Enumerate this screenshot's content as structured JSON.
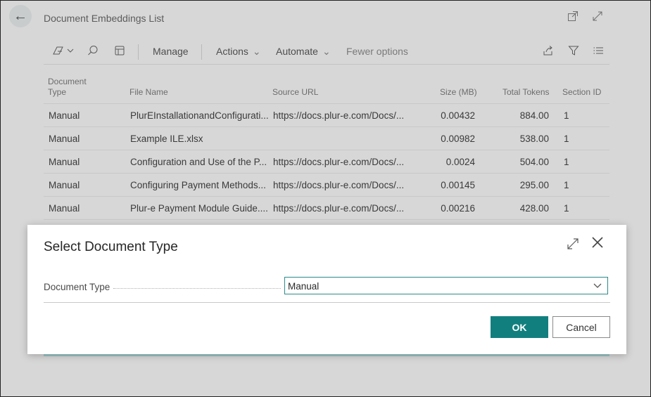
{
  "header": {
    "title": "Document Embeddings List",
    "icons": [
      "back-arrow-icon",
      "open-in-new-window-icon",
      "expand-icon"
    ]
  },
  "actionbar": {
    "manage": "Manage",
    "actions": "Actions",
    "automate": "Automate",
    "fewer_options": "Fewer options",
    "icons": [
      "view-switch-icon",
      "search-icon",
      "tile-view-icon",
      "share-icon",
      "filter-icon",
      "list-view-icon"
    ]
  },
  "table": {
    "columns": [
      "Document Type",
      "File Name",
      "Source URL",
      "Size (MB)",
      "Total Tokens",
      "Section ID"
    ],
    "rows": [
      [
        "Manual",
        "PlurEInstallationandConfigurati...",
        "https://docs.plur-e.com/Docs/...",
        "0.00432",
        "884.00",
        "1"
      ],
      [
        "Manual",
        "Example ILE.xlsx",
        "",
        "0.00982",
        "538.00",
        "1"
      ],
      [
        "Manual",
        "Configuration and Use of the P...",
        "https://docs.plur-e.com/Docs/...",
        "0.0024",
        "504.00",
        "1"
      ],
      [
        "Manual",
        "Configuring Payment Methods...",
        "https://docs.plur-e.com/Docs/...",
        "0.00145",
        "295.00",
        "1"
      ],
      [
        "Manual",
        "Plur-e Payment Module Guide....",
        "https://docs.plur-e.com/Docs/...",
        "0.00216",
        "428.00",
        "1"
      ]
    ]
  },
  "dialog": {
    "title": "Select Document Type",
    "field_label": "Document Type",
    "field_value": "Manual",
    "ok": "OK",
    "cancel": "Cancel"
  },
  "colors": {
    "accent": "#127f7f",
    "overlay": "#d7d7d7"
  }
}
